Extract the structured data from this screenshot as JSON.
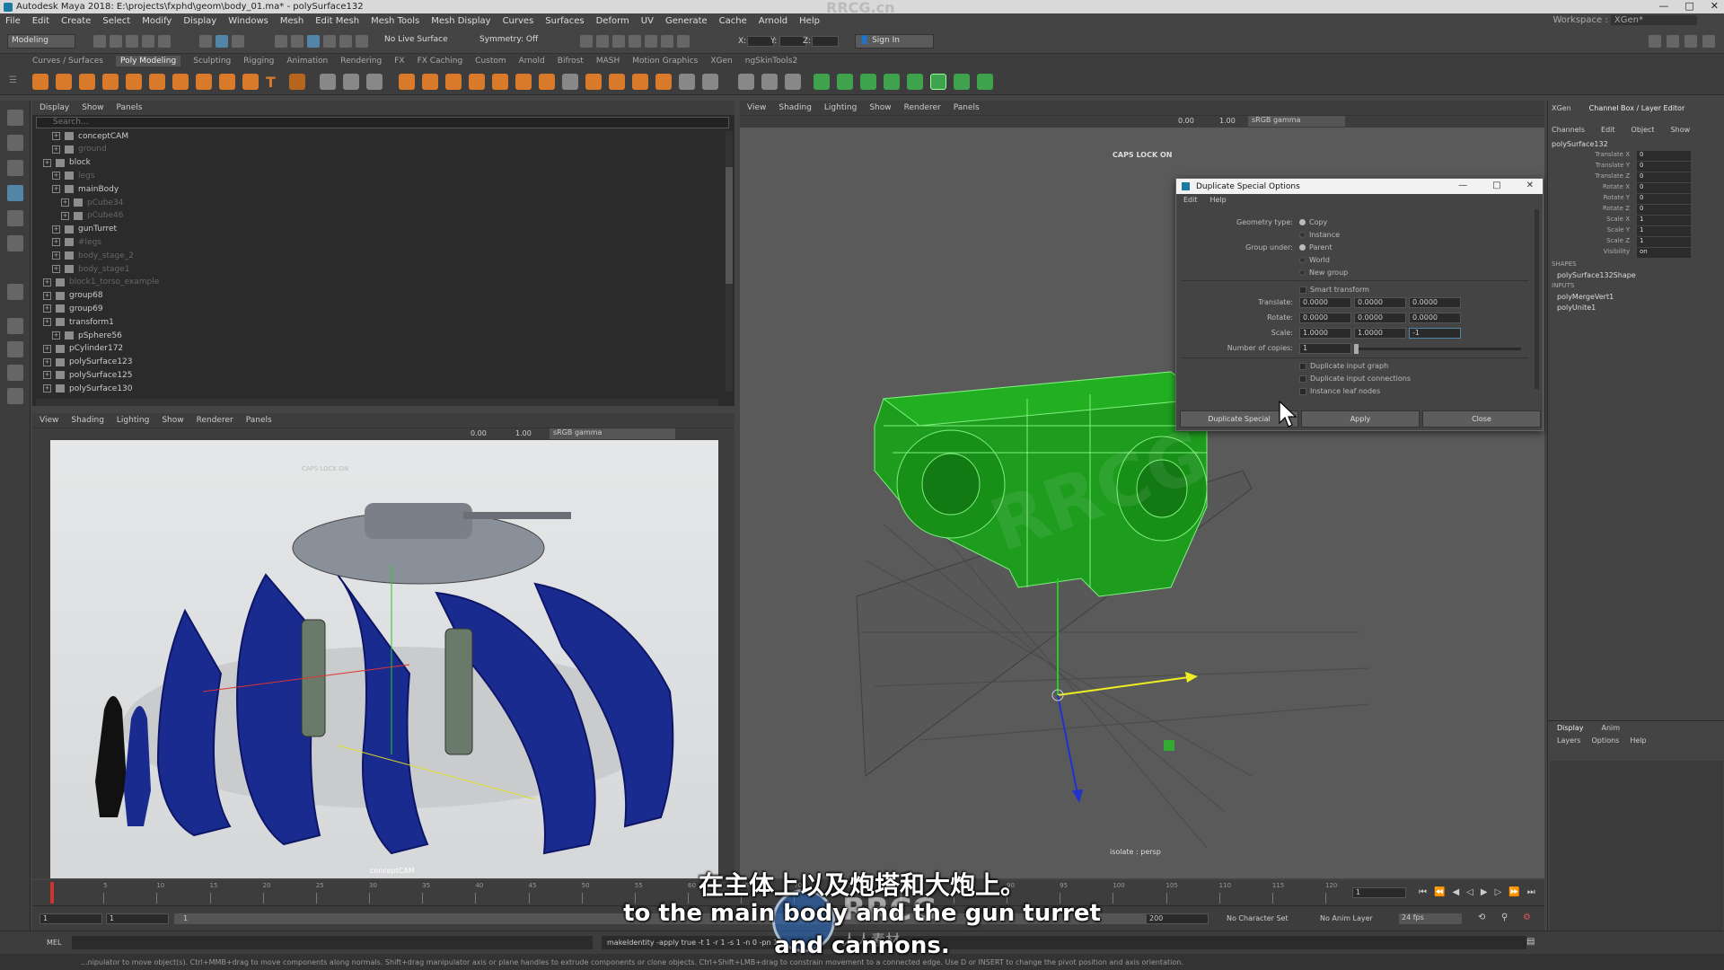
{
  "titlebar": {
    "title": "Autodesk Maya 2018: E:\\projects\\fxphd\\geom\\body_01.ma*  -  polySurface132",
    "brand": "RRCG.cn",
    "controls": [
      "—",
      "□",
      "✕"
    ]
  },
  "menubar": {
    "items": [
      "File",
      "Edit",
      "Create",
      "Select",
      "Modify",
      "Display",
      "Windows",
      "Mesh",
      "Edit Mesh",
      "Mesh Tools",
      "Mesh Display",
      "Curves",
      "Surfaces",
      "Deform",
      "UV",
      "Generate",
      "Cache",
      "Arnold",
      "Help"
    ],
    "workspace_label": "Workspace :",
    "workspace_value": "XGen*"
  },
  "statusline": {
    "mode": "Modeling",
    "live_surface": "No Live Surface",
    "symmetry": "Symmetry: Off",
    "x_label": "X:",
    "y_label": "Y:",
    "z_label": "Z:",
    "sign_in": "Sign In"
  },
  "shelf_tabs": [
    "Curves / Surfaces",
    "Poly Modeling",
    "Sculpting",
    "Rigging",
    "Animation",
    "Rendering",
    "FX",
    "FX Caching",
    "Custom",
    "Arnold",
    "Bifrost",
    "MASH",
    "Motion Graphics",
    "XGen",
    "ngSkinTools2"
  ],
  "shelf_active": "Poly Modeling",
  "outliner": {
    "menu": [
      "Display",
      "Show",
      "Panels"
    ],
    "search_placeholder": "Search...",
    "rows": [
      {
        "label": "conceptCAM",
        "indent": 1,
        "dim": false
      },
      {
        "label": "ground",
        "indent": 1,
        "dim": true
      },
      {
        "label": "block",
        "indent": 0,
        "dim": false
      },
      {
        "label": "legs",
        "indent": 1,
        "dim": true
      },
      {
        "label": "mainBody",
        "indent": 1,
        "dim": false
      },
      {
        "label": "pCube34",
        "indent": 2,
        "dim": true
      },
      {
        "label": "pCube46",
        "indent": 2,
        "dim": true
      },
      {
        "label": "gunTurret",
        "indent": 1,
        "dim": false
      },
      {
        "label": "#legs",
        "indent": 1,
        "dim": true
      },
      {
        "label": "body_stage_2",
        "indent": 1,
        "dim": true
      },
      {
        "label": "body_stage1",
        "indent": 1,
        "dim": true
      },
      {
        "label": "block1_torso_example",
        "indent": 0,
        "dim": true
      },
      {
        "label": "group68",
        "indent": 0,
        "dim": false
      },
      {
        "label": "group69",
        "indent": 0,
        "dim": false
      },
      {
        "label": "transform1",
        "indent": 0,
        "dim": false
      },
      {
        "label": "pSphere56",
        "indent": 1,
        "dim": false
      },
      {
        "label": "pCylinder172",
        "indent": 0,
        "dim": false
      },
      {
        "label": "polySurface123",
        "indent": 0,
        "dim": false
      },
      {
        "label": "polySurface125",
        "indent": 0,
        "dim": false
      },
      {
        "label": "polySurface130",
        "indent": 0,
        "dim": false
      }
    ]
  },
  "viewport_left": {
    "menu": [
      "View",
      "Shading",
      "Lighting",
      "Show",
      "Renderer",
      "Panels"
    ],
    "exposure": "0.00",
    "gamma": "1.00",
    "colorspace": "sRGB gamma",
    "caps": "CAPS LOCK ON",
    "camera": "conceptCAM"
  },
  "viewport_right": {
    "menu": [
      "View",
      "Shading",
      "Lighting",
      "Show",
      "Renderer",
      "Panels"
    ],
    "exposure": "0.00",
    "gamma": "1.00",
    "colorspace": "sRGB gamma",
    "caps": "CAPS LOCK ON",
    "camera": "isolate : persp"
  },
  "dialog": {
    "title": "Duplicate Special Options",
    "menu": [
      "Edit",
      "Help"
    ],
    "geometry_type_label": "Geometry type:",
    "geometry_options": [
      "Copy",
      "Instance"
    ],
    "group_under_label": "Group under:",
    "group_options": [
      "Parent",
      "World",
      "New group"
    ],
    "smart_transform": "Smart transform",
    "translate_label": "Translate:",
    "translate": [
      "0.0000",
      "0.0000",
      "0.0000"
    ],
    "rotate_label": "Rotate:",
    "rotate": [
      "0.0000",
      "0.0000",
      "0.0000"
    ],
    "scale_label": "Scale:",
    "scale": [
      "1.0000",
      "1.0000",
      "-1"
    ],
    "copies_label": "Number of copies:",
    "copies": "1",
    "copies_fraction": 0.0,
    "checks": [
      "Duplicate input graph",
      "Duplicate input connections",
      "Instance leaf nodes"
    ],
    "buttons": [
      "Duplicate Special",
      "Apply",
      "Close"
    ]
  },
  "channel_box": {
    "tabs": [
      "XGen",
      "Channel Box / Layer Editor"
    ],
    "menu": [
      "Channels",
      "Edit",
      "Object",
      "Show"
    ],
    "object": "polySurface132",
    "attrs": [
      {
        "name": "Translate X",
        "value": "0"
      },
      {
        "name": "Translate Y",
        "value": "0"
      },
      {
        "name": "Translate Z",
        "value": "0"
      },
      {
        "name": "Rotate X",
        "value": "0"
      },
      {
        "name": "Rotate Y",
        "value": "0"
      },
      {
        "name": "Rotate Z",
        "value": "0"
      },
      {
        "name": "Scale X",
        "value": "1"
      },
      {
        "name": "Scale Y",
        "value": "1"
      },
      {
        "name": "Scale Z",
        "value": "1"
      },
      {
        "name": "Visibility",
        "value": "on"
      }
    ],
    "shapes_label": "SHAPES",
    "shape": "polySurface132Shape",
    "inputs_label": "INPUTS",
    "inputs": [
      "polyMergeVert1",
      "polyUnite1"
    ],
    "layer_tabs": [
      "Display",
      "Anim"
    ],
    "layer_menu": [
      "Layers",
      "Options",
      "Help"
    ]
  },
  "timeline": {
    "current_frame": "1",
    "ticks": [
      "1",
      "5",
      "10",
      "15",
      "20",
      "25",
      "30",
      "35",
      "40",
      "45",
      "50",
      "55",
      "60",
      "65",
      "70",
      "75",
      "80",
      "85",
      "90",
      "95",
      "100",
      "105",
      "110",
      "115",
      "120"
    ]
  },
  "range": {
    "start": "1",
    "start2": "1",
    "slider_start": "1",
    "end": "200",
    "character_set": "No Character Set",
    "anim_layer": "No Anim Layer",
    "fps": "24 fps"
  },
  "command": {
    "mel_label": "MEL",
    "output": "makeIdentity -apply true -t 1 -r 1 -s 1 -n 0 -pn 1;"
  },
  "help_line": "...nipulator to move object(s). Ctrl+MMB+drag to move components along normals. Shift+drag manipulator axis or plane handles to extrude components or clone objects. Ctrl+Shift+LMB+drag to constrain movement to a connected edge. Use D or INSERT to change the pivot position and axis orientation.",
  "subtitles": {
    "chinese": "在主体上以及炮塔和大炮上。",
    "english_1": "to the main body and the gun turret",
    "english_2": "and cannons."
  },
  "watermark": {
    "logo_text": "RRCG",
    "logo_sub": "人人素材"
  },
  "colors": {
    "accent": "#5285a6",
    "mesh_green": "#1e9c1e",
    "mesh_blue": "#12238a"
  }
}
